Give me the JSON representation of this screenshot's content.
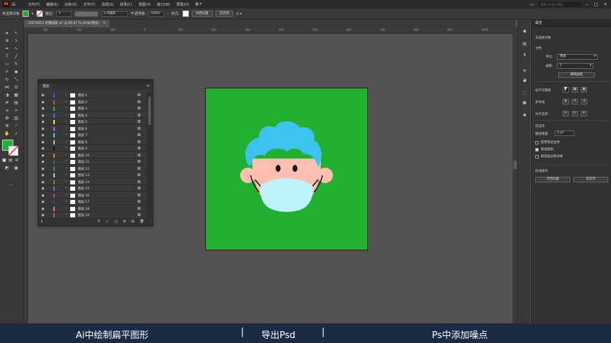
{
  "menubar": {
    "logo": "Ai",
    "items": [
      "文件(F)",
      "编辑(E)",
      "对象(O)",
      "文字(T)",
      "选择(S)",
      "效果(C)",
      "视图(V)",
      "窗口(W)",
      "帮助(H)"
    ],
    "search_placeholder": "搜索 Adobe 帮助"
  },
  "control": {
    "selection": "未选择对象",
    "stroke_label": "描边:",
    "points": "3 点圆形",
    "opacity_label": "不透明度:",
    "opacity": "100%",
    "style_label": "样式:",
    "doc_setup": "文档设置",
    "prefs": "首选项"
  },
  "document": {
    "tab": "20210611 折腰画家.ai* @ 66.67 % (RGB/预览)"
  },
  "ruler": {
    "h_ticks": [
      "300",
      "200",
      "100",
      "0",
      "100",
      "200",
      "300",
      "400",
      "500",
      "600",
      "700",
      "800",
      "900",
      "1000",
      "1100"
    ],
    "v_ticks": [
      "1",
      "0",
      "0",
      "1",
      "0",
      "0",
      "2",
      "0",
      "0",
      "3",
      "0",
      "0",
      "4",
      "0",
      "0",
      "5",
      "0",
      "0",
      "6",
      "0",
      "0",
      "7",
      "0",
      "0",
      "8",
      "0",
      "0"
    ]
  },
  "layers": {
    "tab": "图层",
    "rows": [
      {
        "name": "图层 1",
        "color": "#4b4bff"
      },
      {
        "name": "图层 2",
        "color": "#e04848"
      },
      {
        "name": "图层 3",
        "color": "#3fb04f"
      },
      {
        "name": "图层 4",
        "color": "#5a6bff"
      },
      {
        "name": "图层 5",
        "color": "#ffe84a"
      },
      {
        "name": "图层 6",
        "color": "#c85cff"
      },
      {
        "name": "图层 7",
        "color": "#4fd6e0"
      },
      {
        "name": "图层 8",
        "color": "#c8c8c8"
      },
      {
        "name": "图层 9",
        "color": "#111111"
      },
      {
        "name": "图层 10",
        "color": "#e08a3a"
      },
      {
        "name": "图层 11",
        "color": "#2d7a3f"
      },
      {
        "name": "图层 12",
        "color": "#3a7ac8"
      },
      {
        "name": "图层 13",
        "color": "#c8c8c8"
      },
      {
        "name": "图层 14",
        "color": "#6b8a3a"
      },
      {
        "name": "图层 15",
        "color": "#9b59d0"
      },
      {
        "name": "图层 16",
        "color": "#d04a4a"
      },
      {
        "name": "图层 17",
        "color": "#2a3fb0"
      },
      {
        "name": "图层 18",
        "color": "#e07ab0"
      },
      {
        "name": "图层 19",
        "color": "#c85a5a"
      }
    ]
  },
  "properties": {
    "title": "属性",
    "no_selection": "未选择对象",
    "document_label": "文档",
    "units_label": "单位:",
    "units_value": "像素",
    "artboard_label": "画板:",
    "artboard_value": "1",
    "edit_artboards": "编辑画板",
    "ruler_grid": "标尺与网格",
    "guides": "参考线",
    "align_to": "对齐选项",
    "preferences": "首选项",
    "keyboard_increment_label": "键盘增量:",
    "keyboard_increment": "1 px",
    "check1": "使用预览边界",
    "check2": "缩放圆角",
    "check3": "缩放描边和效果",
    "quick_actions": "快速操作",
    "doc_setup_btn": "文档设置",
    "prefs_btn": "首选项"
  },
  "caption": {
    "part1": "Ai中绘制扁平图形",
    "sep": "|",
    "part2": "导出Psd",
    "part3": "Ps中添加噪点"
  },
  "colors": {
    "artboard": "#22b033",
    "hair": "#3cc3f0",
    "skin": "#ffbfb0",
    "mask": "#bff3fb",
    "caption_bg": "#1b2b45"
  }
}
